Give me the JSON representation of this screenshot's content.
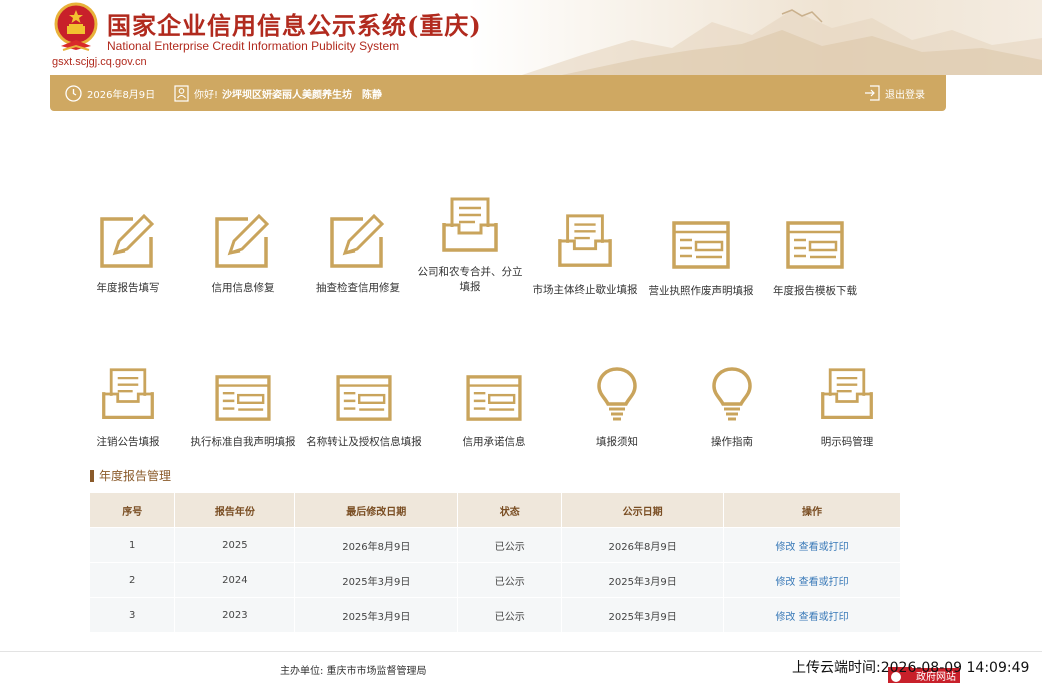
{
  "header": {
    "title": "国家企业信用信息公示系统(重庆)",
    "subtitle": "National Enterprise Credit Information Publicity System",
    "domain": "gsxt.scjgj.cq.gov.cn"
  },
  "topbar": {
    "date": "2026年8月9日",
    "greeting": "你好!",
    "enterprise": "沙坪坝区妍姿丽人美颜养生坊",
    "person": "陈静",
    "logout": "退出登录"
  },
  "functions": [
    {
      "label": "年度报告填写",
      "icon": "pen-icon"
    },
    {
      "label": "信用信息修复",
      "icon": "pen-icon"
    },
    {
      "label": "抽查检查信用修复",
      "icon": "pen-icon"
    },
    {
      "label": "公司和农专合并、分立",
      "label2": "填报",
      "icon": "inbox-icon"
    },
    {
      "label": "市场主体终止歇业填报",
      "icon": "inbox-icon"
    },
    {
      "label": "营业执照作废声明填报",
      "icon": "form-icon"
    },
    {
      "label": "年度报告模板下载",
      "icon": "form-icon"
    },
    {
      "label": "注销公告填报",
      "icon": "inbox-icon"
    },
    {
      "label": "执行标准自我声明填报",
      "icon": "form-icon"
    },
    {
      "label": "名称转让及授权信息填报",
      "icon": "form-icon"
    },
    {
      "label": "信用承诺信息",
      "icon": "form-icon"
    },
    {
      "label": "填报须知",
      "icon": "lightbulb-icon"
    },
    {
      "label": "操作指南",
      "icon": "lightbulb-icon"
    },
    {
      "label": "明示码管理",
      "icon": "inbox-icon"
    }
  ],
  "report_section": {
    "title": "年度报告管理",
    "headers": [
      "序号",
      "报告年份",
      "最后修改日期",
      "状态",
      "公示日期",
      "操作"
    ],
    "rows": [
      {
        "no": "1",
        "year": "2025",
        "modified": "2026年8月9日",
        "status": "已公示",
        "published": "2026年8月9日",
        "edit": "修改",
        "view": "查看或打印"
      },
      {
        "no": "2",
        "year": "2024",
        "modified": "2025年3月9日",
        "status": "已公示",
        "published": "2025年3月9日",
        "edit": "修改",
        "view": "查看或打印"
      },
      {
        "no": "3",
        "year": "2023",
        "modified": "2025年3月9日",
        "status": "已公示",
        "published": "2025年3月9日",
        "edit": "修改",
        "view": "查看或打印"
      }
    ]
  },
  "footer": {
    "host": "主办单位:  重庆市市场监督管理局",
    "upload_time": "上传云端时间:2026-08-09 14:09:49",
    "gov_site": "政府网站"
  },
  "colors": {
    "accent": "#cfa862",
    "title_red": "#b12a1e",
    "link": "#3a7ab8"
  }
}
